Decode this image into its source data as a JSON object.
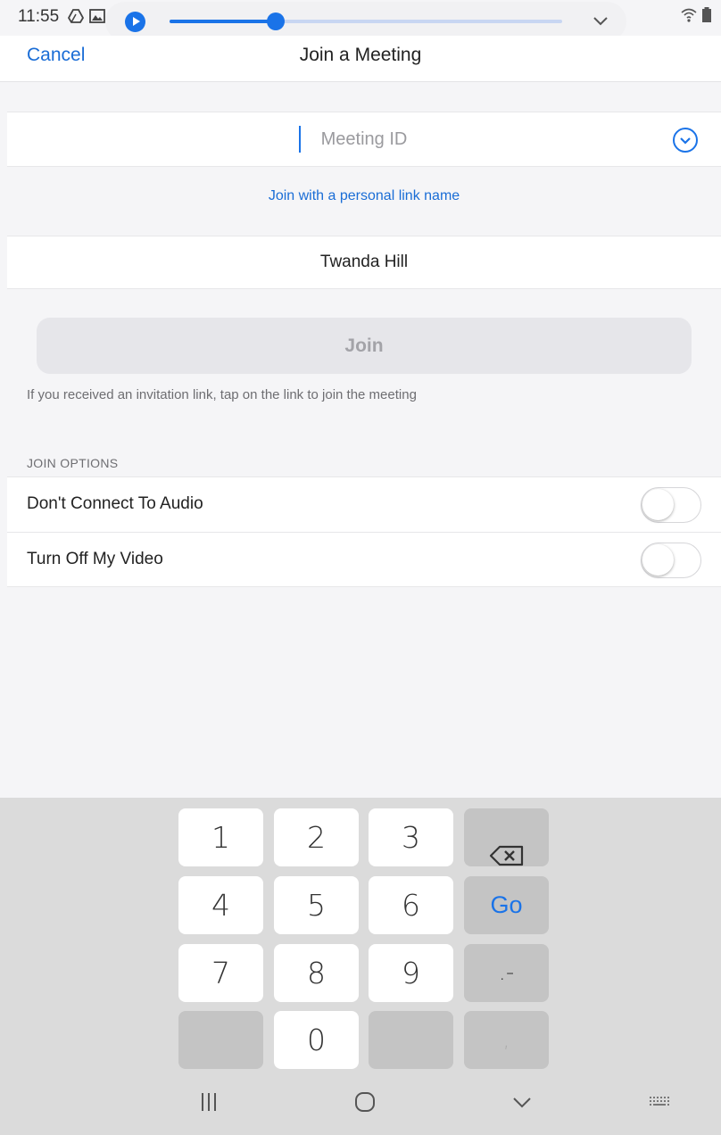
{
  "status_bar": {
    "time": "11:55"
  },
  "media": {
    "progress": 0.27
  },
  "header": {
    "cancel_label": "Cancel",
    "title": "Join a Meeting"
  },
  "meeting_id": {
    "placeholder": "Meeting ID",
    "value": ""
  },
  "personal_link_label": "Join with a personal link name",
  "display_name": {
    "value": "Twanda Hill"
  },
  "join_button_label": "Join",
  "invitation_hint": "If you received an invitation link, tap on the link to join the meeting",
  "join_options": {
    "header": "JOIN OPTIONS",
    "items": [
      {
        "label": "Don't Connect To Audio",
        "enabled": false
      },
      {
        "label": "Turn Off My Video",
        "enabled": false
      }
    ]
  },
  "keyboard": {
    "digits": [
      "1",
      "2",
      "3",
      "4",
      "5",
      "6",
      "7",
      "8",
      "9",
      "0"
    ],
    "go_label": "Go",
    "dot_dash": ".-",
    "comma": ","
  },
  "colors": {
    "accent": "#1a73e8",
    "link": "#1a6dd6"
  }
}
